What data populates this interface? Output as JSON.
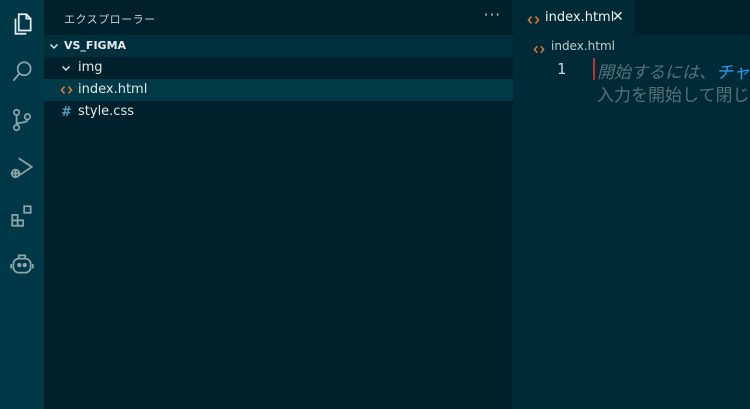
{
  "activity_bar": {
    "items": [
      {
        "icon": "files-icon",
        "active": true
      },
      {
        "icon": "search-icon"
      },
      {
        "icon": "source-control-icon"
      },
      {
        "icon": "run-debug-icon"
      },
      {
        "icon": "extensions-icon"
      },
      {
        "icon": "copilot-icon"
      }
    ]
  },
  "sidebar": {
    "title": "エクスプローラー",
    "more_label": "···",
    "folder_name": "VS_FIGMA",
    "items": [
      {
        "label": "img",
        "icon": "chevron-down-icon",
        "type": "folder"
      },
      {
        "label": "index.html",
        "icon": "html-file-icon",
        "type": "file",
        "selected": true
      },
      {
        "label": "style.css",
        "icon": "css-file-icon",
        "type": "file"
      }
    ]
  },
  "editor": {
    "tab": {
      "label": "index.html",
      "close_label": "✕"
    },
    "breadcrumb": "index.html",
    "line_number": "1",
    "hint_line1_text": "開始するには、",
    "hint_line1_link": "チャ",
    "hint_line2": "入力を開始して閉じ"
  },
  "colors": {
    "activity_bar": "#003847",
    "sidebar": "#00212b",
    "editor": "#002b36",
    "html_icon": "#e37933",
    "css_icon": "#519aba",
    "link": "#2a9df4"
  }
}
